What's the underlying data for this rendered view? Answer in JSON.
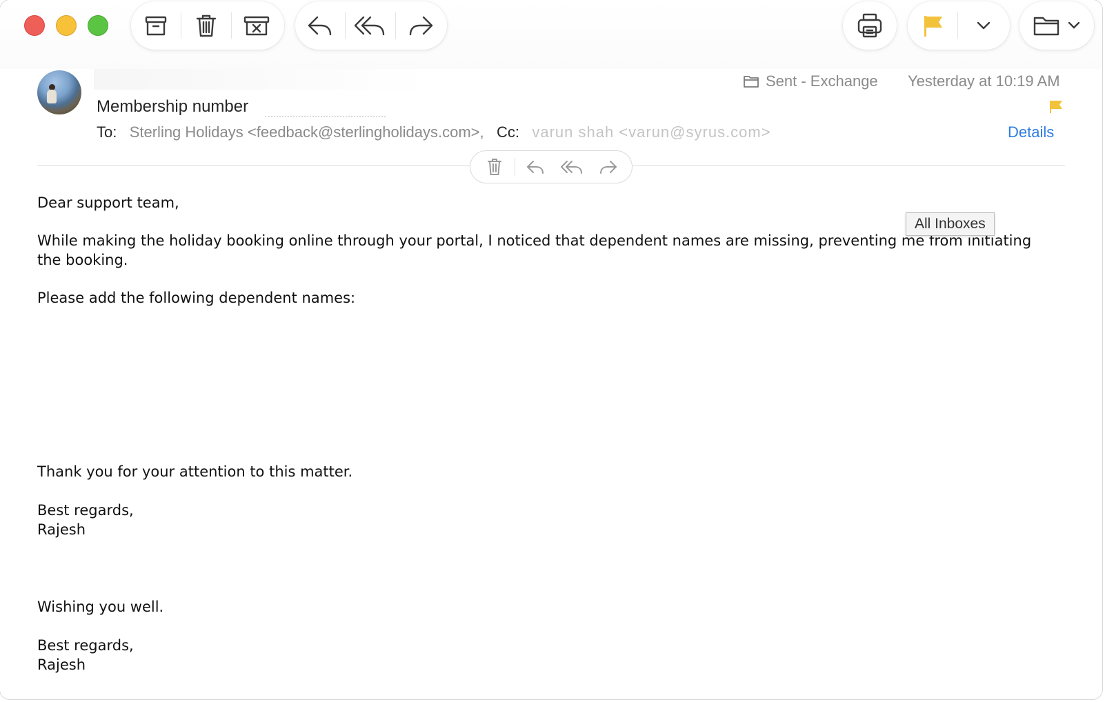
{
  "toolbar": {
    "archive_icon": "archive-icon",
    "delete_icon": "trash-icon",
    "junk_icon": "junk-icon",
    "reply_icon": "reply-icon",
    "reply_all_icon": "reply-all-icon",
    "forward_icon": "forward-icon",
    "print_icon": "print-icon",
    "flag_icon": "flag-icon",
    "flag_color": "#f3c23b",
    "move_icon": "folder-icon"
  },
  "header": {
    "subject": "Membership number",
    "mailbox": "Sent - Exchange",
    "date": "Yesterday at 10:19 AM",
    "to_label": "To:",
    "to_value": "Sterling Holidays <feedback@sterlingholidays.com>,",
    "cc_label": "Cc:",
    "cc_value": "varun shah <varun@syrus.com>",
    "details_label": "Details",
    "details_color": "#2f7de1"
  },
  "tooltip": {
    "text": "All Inboxes"
  },
  "message": {
    "greeting": "Dear support team,",
    "para1": "While making the holiday booking online through your portal, I noticed that dependent names are missing, preventing me from initiating the booking.",
    "para2": "Please add the following dependent names:",
    "thanks": "Thank you for your attention to this matter.",
    "regards1": "Best regards,",
    "name1": "Rajesh",
    "wish": "Wishing you well.",
    "regards2": "Best regards,",
    "name2": "Rajesh"
  }
}
